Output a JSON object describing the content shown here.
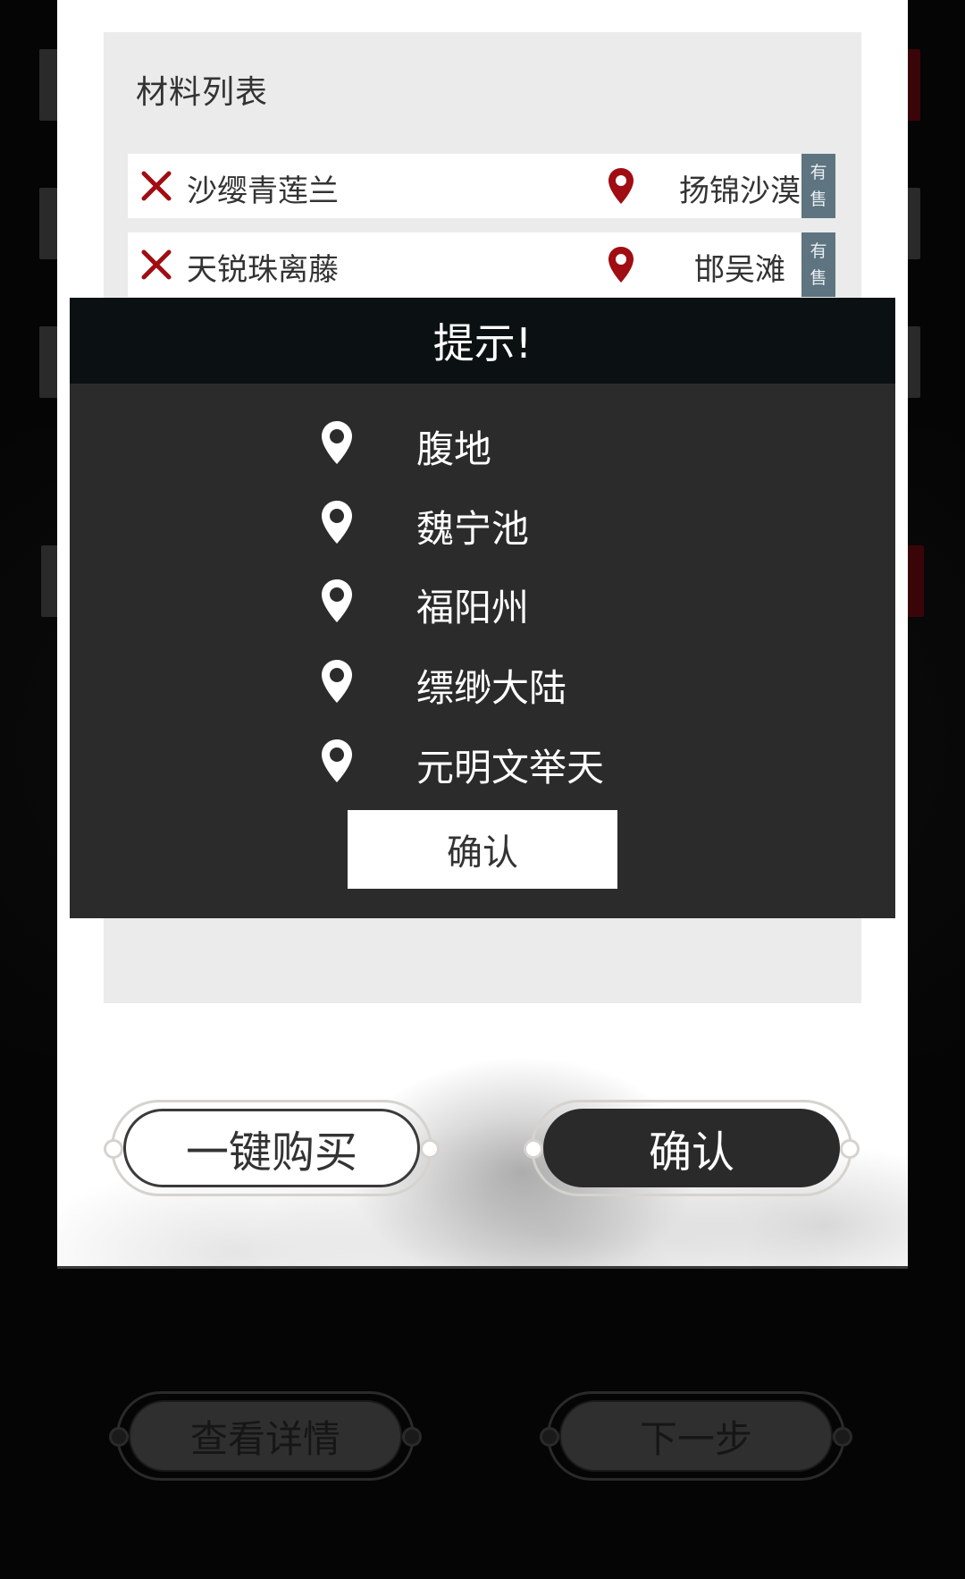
{
  "materials": {
    "title": "材料列表",
    "rows": [
      {
        "name": "沙缨青莲兰",
        "location": "扬锦沙漠",
        "badge_line1": "有",
        "badge_line2": "售"
      },
      {
        "name": "天锐珠离藤",
        "location": "邯吴滩",
        "badge_line1": "有",
        "badge_line2": "售"
      }
    ]
  },
  "dialog": {
    "title": "提示!",
    "locations": [
      "腹地",
      "魏宁池",
      "福阳州",
      "缥缈大陆",
      "元明文举天"
    ],
    "confirm_label": "确认"
  },
  "actions": {
    "buy_all_label": "一键购买",
    "confirm_label": "确认"
  },
  "footer": {
    "details_label": "查看详情",
    "next_label": "下一步"
  },
  "colors": {
    "accent_red": "#a00d12",
    "badge_bg": "#5e7480",
    "modal_bg": "#2b2b2b",
    "modal_header_bg": "#0b1012"
  },
  "icons": {
    "remove": "close-x-icon",
    "location": "map-pin-icon"
  }
}
